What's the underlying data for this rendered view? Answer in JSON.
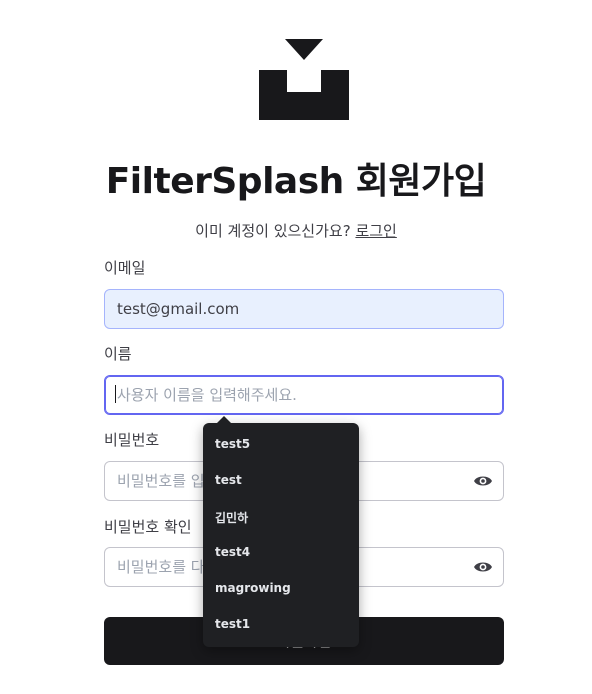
{
  "header": {
    "title": "FilterSplash 회원가입",
    "subtitle_prefix": "이미 계정이 있으신가요?",
    "login_link": "로그인"
  },
  "form": {
    "email": {
      "label": "이메일",
      "value": "test@gmail.com"
    },
    "name": {
      "label": "이름",
      "placeholder": "사용자 이름을 입력해주세요."
    },
    "password": {
      "label": "비밀번호",
      "placeholder": "비밀번호를 입"
    },
    "password_confirm": {
      "label": "비밀번호 확인",
      "placeholder": "비밀번호를 다"
    },
    "submit_label": "회원가입"
  },
  "autocomplete": {
    "items": [
      "test5",
      "test",
      "깁민하",
      "test4",
      "magrowing",
      "test1"
    ]
  },
  "icons": {
    "logo": "download-tray-icon",
    "eye": "eye-icon"
  },
  "colors": {
    "primary": "#18181b",
    "focus": "#6366f1",
    "autofill_bg": "#e8f0fe",
    "dropdown_bg": "#1f2023"
  }
}
